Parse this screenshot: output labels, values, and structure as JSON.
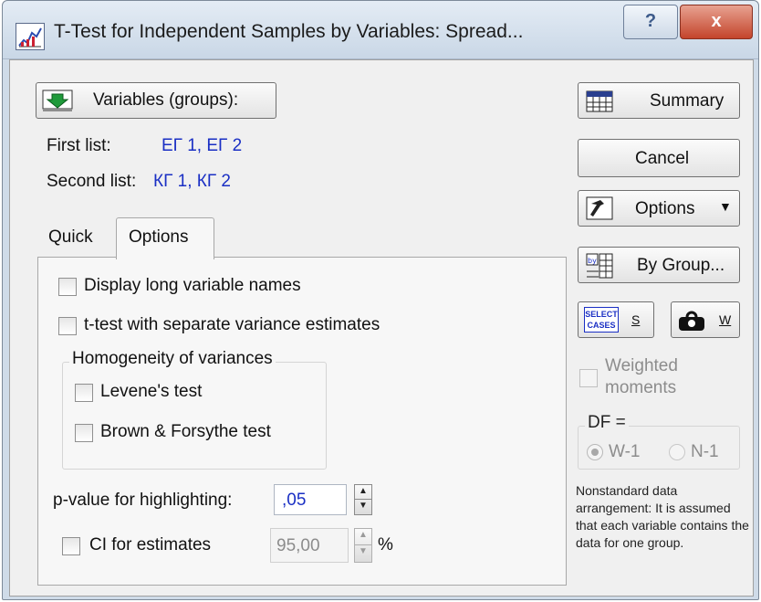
{
  "window": {
    "title": "T-Test for Independent Samples by Variables: Spread...",
    "help_label": "?",
    "close_label": "x"
  },
  "variables": {
    "button_label": "Variables (groups):",
    "first_list_label": "First list:",
    "first_list_value": "ЕГ 1, ЕГ 2",
    "second_list_label": "Second list:",
    "second_list_value": "КГ 1, КГ 2"
  },
  "tabs": [
    {
      "label": "Quick",
      "active": false
    },
    {
      "label": "Options",
      "active": true
    }
  ],
  "options": {
    "display_long_names": "Display long variable names",
    "separate_variance": "t-test with separate variance estimates",
    "homogeneity_title": "Homogeneity of variances",
    "levene": "Levene's test",
    "brown_forsythe": "Brown & Forsythe test",
    "pvalue_label": "p-value for highlighting:",
    "pvalue_value": ",05",
    "ci_label": "CI for estimates",
    "ci_value": "95,00",
    "ci_unit": "%"
  },
  "side": {
    "summary": "Summary",
    "cancel": "Cancel",
    "options": "Options",
    "by_group": "By Group...",
    "select_cases_line1": "SELECT",
    "select_cases_line2": "CASES",
    "select_cases_key": "S",
    "weight_key": "W",
    "weighted": "Weighted moments",
    "df_title": "DF =",
    "df_w1": "W-1",
    "df_n1": "N-1",
    "note": "Nonstandard data arrangement: It is assumed that each variable contains the data for one group."
  },
  "icons": {
    "app": "chart-window-icon",
    "variables": "variables-arrow-icon",
    "summary": "summary-table-icon",
    "options": "hammer-icon",
    "by_group": "by-group-icon",
    "weight": "weight-icon"
  },
  "colors": {
    "variable_text": "#1a2fc4",
    "close_button": "#c4442b",
    "disabled_text": "#8c8c8c"
  }
}
